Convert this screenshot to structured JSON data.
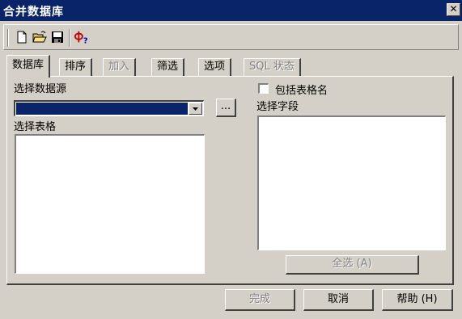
{
  "window": {
    "title": "合并数据库",
    "close_glyph": "✕"
  },
  "toolbar": {
    "buttons": [
      {
        "name": "new-document-icon"
      },
      {
        "name": "open-folder-icon"
      },
      {
        "name": "save-disk-icon"
      },
      {
        "name": "field-help-icon"
      }
    ]
  },
  "tabs": [
    {
      "label": "数据库",
      "state": "active"
    },
    {
      "label": "排序",
      "state": "normal"
    },
    {
      "label": "加入",
      "state": "disabled"
    },
    {
      "label": "筛选",
      "state": "normal"
    },
    {
      "label": "选项",
      "state": "normal"
    },
    {
      "label": "SQL 状态",
      "state": "disabled"
    }
  ],
  "database_tab": {
    "select_source_label": "选择数据源",
    "combo_value": "",
    "browse_label": "...",
    "select_table_label": "选择表格",
    "include_table_name_label": "包括表格名",
    "include_table_name_checked": false,
    "select_field_label": "选择字段",
    "select_all_label": "全选  (A)"
  },
  "footer": {
    "finish_label": "完成",
    "cancel_label": "取消",
    "help_label": "帮助 (H)"
  },
  "colors": {
    "face": "#d4d0c8",
    "titlebar": "#0a246a",
    "selection": "#0a246a"
  }
}
